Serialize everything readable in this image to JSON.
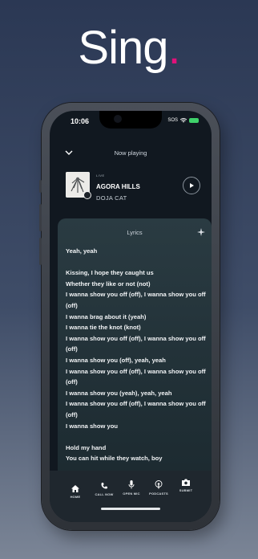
{
  "headline": {
    "text": "Sing",
    "dot": "."
  },
  "status": {
    "time": "10:06",
    "sos": "SOS"
  },
  "player": {
    "header": "Now playing",
    "tag": "LIVE",
    "title": "AGORA HILLS",
    "artist": "DOJA CAT"
  },
  "lyrics": {
    "header": "Lyrics",
    "lines": [
      "Yeah, yeah",
      "",
      "Kissing, I hope they caught us",
      "Whether they like or not (not)",
      "I wanna show you off (off), I wanna show you off",
      "(off)",
      "I wanna brag about it (yeah)",
      "I wanna tie the knot (knot)",
      "I wanna show you off (off), I wanna show you off",
      "(off)",
      "I wanna show you (off), yeah, yeah",
      "I wanna show you off (off), I wanna show you off",
      "(off)",
      "I wanna show you (yeah), yeah, yeah",
      "I wanna show you off (off), I wanna show you off",
      "(off)",
      "I wanna show you",
      "",
      "Hold my hand",
      "You can hit while they watch, boy"
    ]
  },
  "tabs": [
    {
      "label": "HOME",
      "icon": "home-icon"
    },
    {
      "label": "CALL NOW",
      "icon": "phone-icon"
    },
    {
      "label": "OPEN MIC",
      "icon": "microphone-icon"
    },
    {
      "label": "PODCASTS",
      "icon": "podcast-icon"
    },
    {
      "label": "SUBMIT",
      "icon": "camera-icon"
    }
  ],
  "colors": {
    "accent_dot": "#e0117a",
    "background_top": "#2b3854",
    "screen": "#111820"
  }
}
